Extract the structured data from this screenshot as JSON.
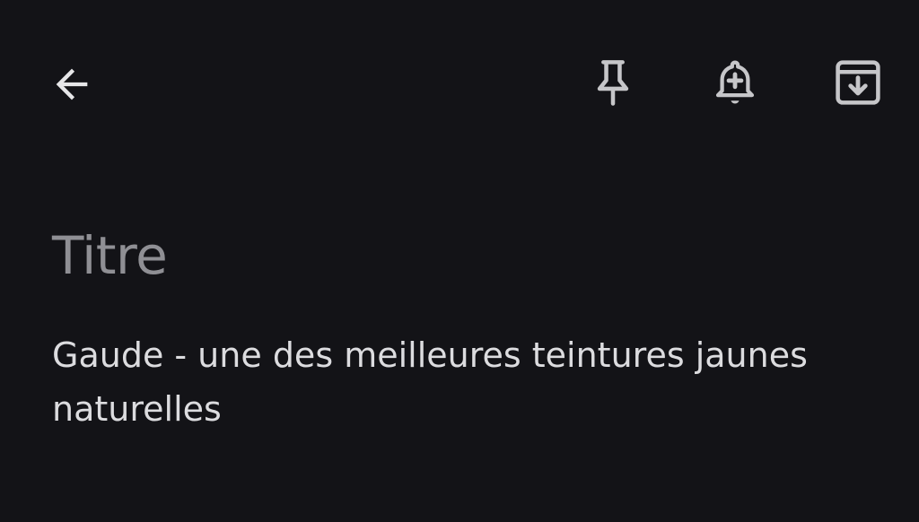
{
  "toolbar": {
    "back_icon": "arrow-left-icon",
    "pin_icon": "pin-icon",
    "reminder_icon": "bell-plus-icon",
    "archive_icon": "archive-icon",
    "icon_color": "#c6c6c9"
  },
  "note": {
    "title_placeholder": "Titre",
    "body_text": "Gaude - une des meilleures teintures jaunes naturelles"
  },
  "colors": {
    "background": "#131317",
    "placeholder": "#8f8f94",
    "text": "#dcdcdf"
  }
}
